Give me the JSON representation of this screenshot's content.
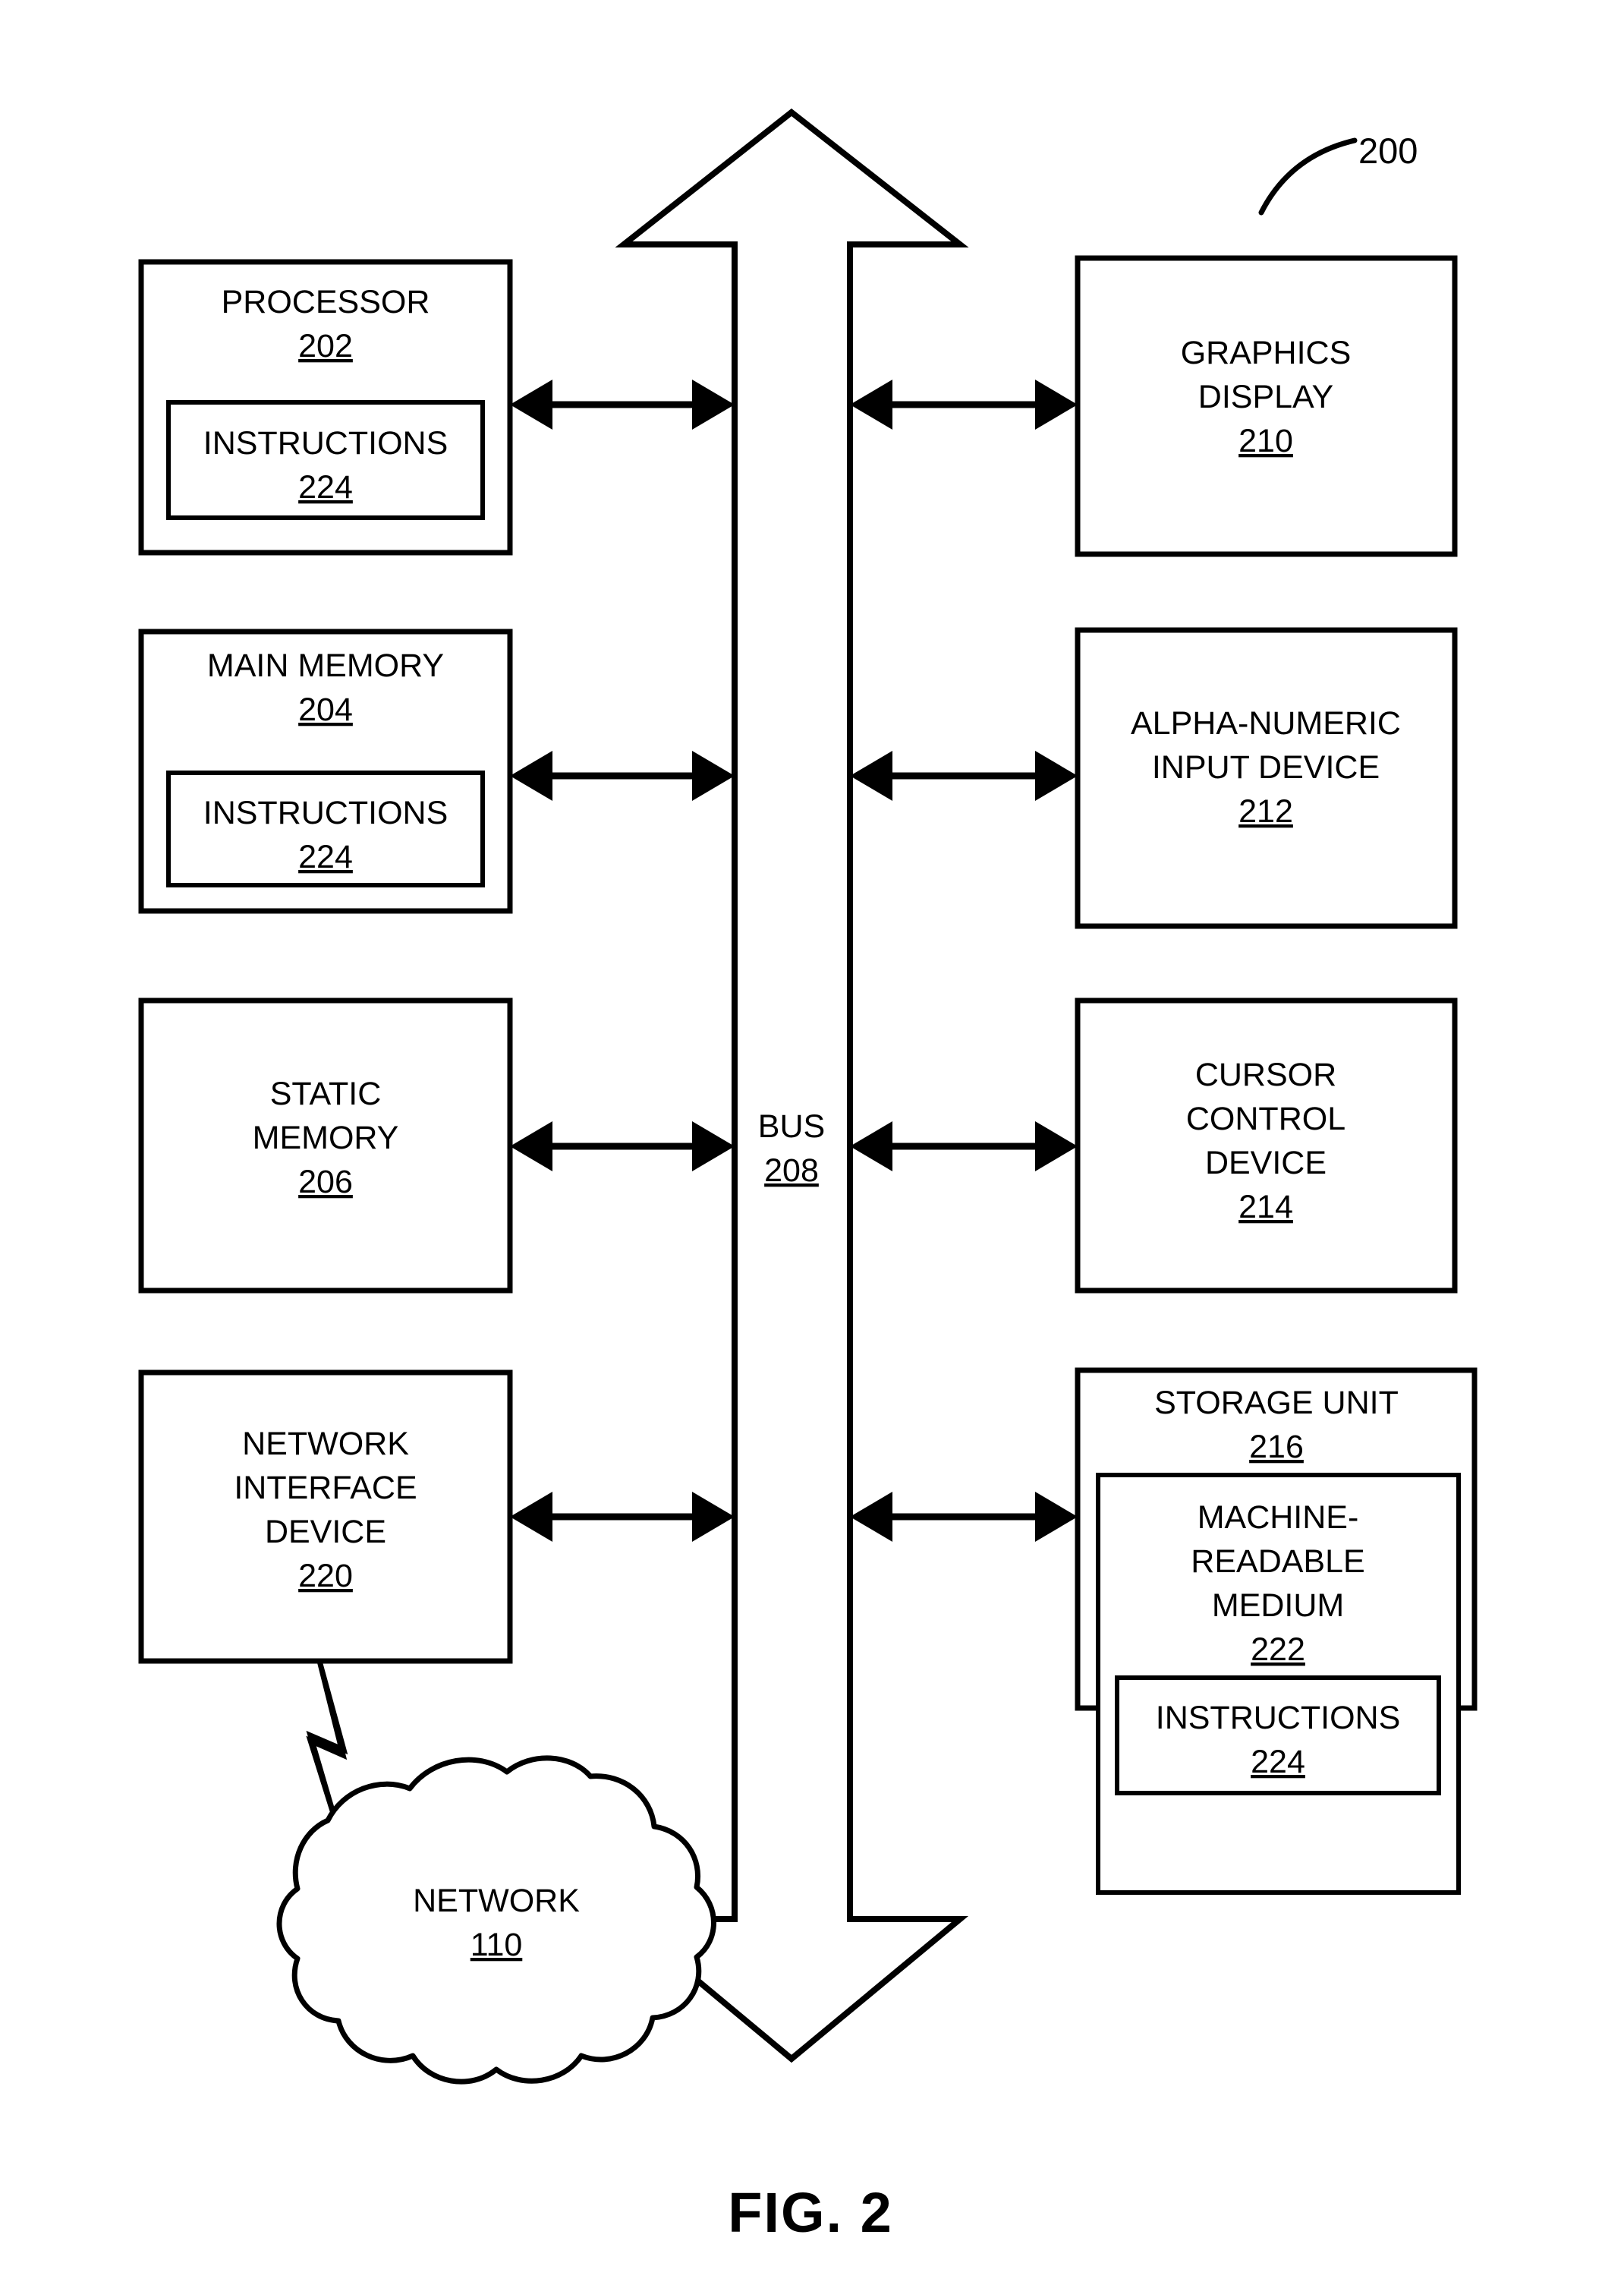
{
  "figure": {
    "caption": "FIG. 2",
    "reference_numeral": "200"
  },
  "bus": {
    "label": "BUS",
    "number": "208"
  },
  "left_column": [
    {
      "name": "processor",
      "title_lines": [
        "PROCESSOR"
      ],
      "number": "202",
      "inner": {
        "name": "instructions",
        "title_lines": [
          "INSTRUCTIONS"
        ],
        "number": "224"
      }
    },
    {
      "name": "main-memory",
      "title_lines": [
        "MAIN MEMORY"
      ],
      "number": "204",
      "inner": {
        "name": "instructions",
        "title_lines": [
          "INSTRUCTIONS"
        ],
        "number": "224"
      }
    },
    {
      "name": "static-memory",
      "title_lines": [
        "STATIC",
        "MEMORY"
      ],
      "number": "206",
      "inner": null
    },
    {
      "name": "network-interface-device",
      "title_lines": [
        "NETWORK",
        "INTERFACE",
        "DEVICE"
      ],
      "number": "220",
      "inner": null
    }
  ],
  "right_column": [
    {
      "name": "graphics-display",
      "title_lines": [
        "GRAPHICS",
        "DISPLAY"
      ],
      "number": "210",
      "inner": null
    },
    {
      "name": "alpha-numeric-input-device",
      "title_lines": [
        "ALPHA-NUMERIC",
        "INPUT DEVICE"
      ],
      "number": "212",
      "inner": null
    },
    {
      "name": "cursor-control-device",
      "title_lines": [
        "CURSOR",
        "CONTROL",
        "DEVICE"
      ],
      "number": "214",
      "inner": null
    },
    {
      "name": "storage-unit",
      "title_lines": [
        "STORAGE UNIT"
      ],
      "number": "216",
      "inner": {
        "name": "machine-readable-medium",
        "title_lines": [
          "MACHINE-",
          "READABLE",
          "MEDIUM"
        ],
        "number": "222",
        "inner": {
          "name": "instructions",
          "title_lines": [
            "INSTRUCTIONS"
          ],
          "number": "224"
        }
      }
    }
  ],
  "network_cloud": {
    "name": "network",
    "label": "NETWORK",
    "number": "110"
  },
  "text": {
    "processor_title": "PROCESSOR",
    "processor_num": "202",
    "processor_instr_title": "INSTRUCTIONS",
    "processor_instr_num": "224",
    "main_memory_title": "MAIN MEMORY",
    "main_memory_num": "204",
    "main_memory_instr_title": "INSTRUCTIONS",
    "main_memory_instr_num": "224",
    "static_memory_l1": "STATIC",
    "static_memory_l2": "MEMORY",
    "static_memory_num": "206",
    "nid_l1": "NETWORK",
    "nid_l2": "INTERFACE",
    "nid_l3": "DEVICE",
    "nid_num": "220",
    "graphics_l1": "GRAPHICS",
    "graphics_l2": "DISPLAY",
    "graphics_num": "210",
    "alphanum_l1": "ALPHA-NUMERIC",
    "alphanum_l2": "INPUT DEVICE",
    "alphanum_num": "212",
    "cursor_l1": "CURSOR",
    "cursor_l2": "CONTROL",
    "cursor_l3": "DEVICE",
    "cursor_num": "214",
    "storage_title": "STORAGE UNIT",
    "storage_num": "216",
    "mrm_l1": "MACHINE-",
    "mrm_l2": "READABLE",
    "mrm_l3": "MEDIUM",
    "mrm_num": "222",
    "mrm_instr_title": "INSTRUCTIONS",
    "mrm_instr_num": "224",
    "bus_label": "BUS",
    "bus_num": "208",
    "network_label": "NETWORK",
    "network_num": "110",
    "ref_200": "200",
    "fig_caption": "FIG. 2"
  },
  "colors": {
    "stroke": "#000000",
    "fill": "#ffffff",
    "background": "#ffffff"
  }
}
